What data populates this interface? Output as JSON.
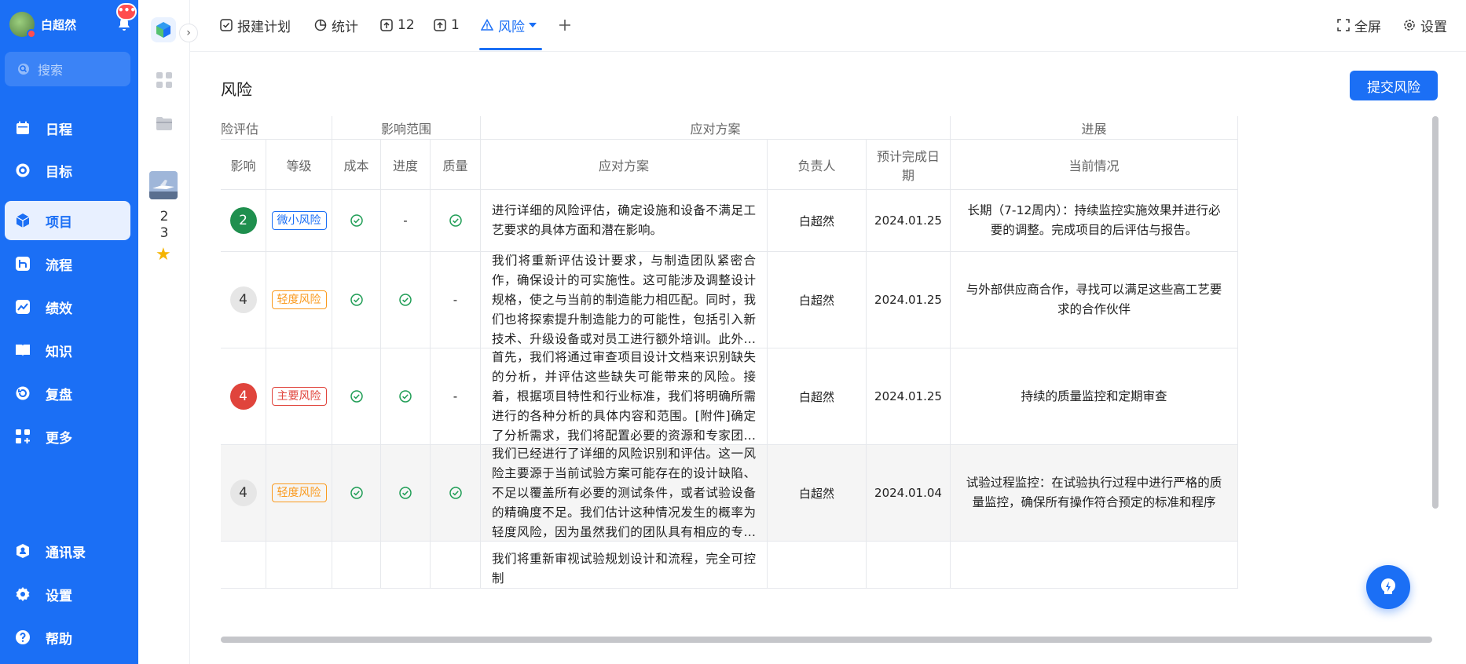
{
  "user": {
    "name": "白超然",
    "notification_badge": "•••"
  },
  "search": {
    "placeholder": "搜索"
  },
  "sidebar": {
    "items": [
      {
        "label": "日程",
        "icon": "calendar-icon"
      },
      {
        "label": "目标",
        "icon": "target-icon"
      },
      {
        "label": "项目",
        "icon": "cube-icon",
        "active": true
      },
      {
        "label": "流程",
        "icon": "flow-icon"
      },
      {
        "label": "绩效",
        "icon": "chart-icon"
      },
      {
        "label": "知识",
        "icon": "book-icon"
      },
      {
        "label": "复盘",
        "icon": "review-icon"
      },
      {
        "label": "更多",
        "icon": "grid-plus-icon"
      }
    ],
    "bottom_items": [
      {
        "label": "通讯录",
        "icon": "contacts-icon"
      },
      {
        "label": "设置",
        "icon": "gear-icon"
      },
      {
        "label": "帮助",
        "icon": "help-icon"
      }
    ]
  },
  "rail": {
    "num_top": "2",
    "num_bottom": "3"
  },
  "tabs": [
    {
      "label": "报建计划",
      "icon": "check-square-icon"
    },
    {
      "label": "统计",
      "icon": "pie-icon"
    },
    {
      "label": "12",
      "icon": "upload-icon"
    },
    {
      "label": "1",
      "icon": "upload-icon"
    },
    {
      "label": "风险",
      "icon": "warning-icon",
      "active": true
    }
  ],
  "top_right": {
    "fullscreen": "全屏",
    "settings": "设置"
  },
  "page": {
    "title": "风险",
    "submit_label": "提交风险"
  },
  "table": {
    "group_headers": [
      "险评估",
      "影响范围",
      "应对方案",
      "进展"
    ],
    "columns": [
      "影响",
      "等级",
      "成本",
      "进度",
      "质量",
      "应对方案",
      "负责人",
      "预计完成日期",
      "当前情况"
    ],
    "rows": [
      {
        "impact": "2",
        "impact_color": "#1f8f4e",
        "level": "微小风险",
        "level_color": "#1b6ff5",
        "cost": "check",
        "schedule": "-",
        "quality": "check",
        "plan": "进行详细的风险评估，确定设施和设备不满足工艺要求的具体方面和潜在影响。",
        "owner": "白超然",
        "date": "2024.01.25",
        "status": "长期（7-12周内）：持续监控实施效果并进行必要的调整。完成项目的后评估与报告。"
      },
      {
        "impact": "4",
        "impact_color": "#e6e6e6",
        "level": "轻度风险",
        "level_color": "#fa9a1e",
        "cost": "check",
        "schedule": "check",
        "quality": "-",
        "plan": "我们将重新评估设计要求，与制造团队紧密合作，确保设计的可实施性。这可能涉及调整设计规格，使之与当前的制造能力相匹配。同时，我们也将探索提升制造能力的可能性，包括引入新技术、升级设备或对员工进行额外培训。此外，我们会考虑与外部供应...",
        "owner": "白超然",
        "date": "2024.01.25",
        "status": "与外部供应商合作，寻找可以满足这些高工艺要求的合作伙伴"
      },
      {
        "impact": "4",
        "impact_color": "#e0443c",
        "level": "主要风险",
        "level_color": "#e0443c",
        "cost": "check",
        "schedule": "check",
        "quality": "-",
        "plan": "首先，我们将通过审查项目设计文档来识别缺失的分析，并评估这些缺失可能带来的风险。接着，根据项目特性和行业标准，我们将明确所需进行的各种分析的具体内容和范围。[附件]确定了分析需求，我们将配置必要的资源和专家团队来执行这些分析。这包...",
        "owner": "白超然",
        "date": "2024.01.25",
        "status": "持续的质量监控和定期审查"
      },
      {
        "impact": "4",
        "impact_color": "#e6e6e6",
        "level": "轻度风险",
        "level_color": "#fa9a1e",
        "cost": "check",
        "schedule": "check",
        "quality": "check",
        "plan": "我们已经进行了详细的风险识别和评估。这一风险主要源于当前试验方案可能存在的设计缺陷、不足以覆盖所有必要的测试条件，或者试验设备的精确度不足。我们估计这种情况发生的概率为轻度风险，因为虽然我们的团队具有相应的专业知识，但试验方案...",
        "owner": "白超然",
        "date": "2024.01.04",
        "status": "试验过程监控：在试验执行过程中进行严格的质量监控，确保所有操作符合预定的标准和程序",
        "highlight": true
      },
      {
        "impact": "",
        "impact_color": "#ffffff",
        "level": "",
        "level_color": "#ffffff",
        "cost": "",
        "schedule": "",
        "quality": "",
        "plan": "我们将重新审视试验规划设计和流程，完全可控制",
        "owner": "",
        "date": "",
        "status": ""
      }
    ]
  }
}
